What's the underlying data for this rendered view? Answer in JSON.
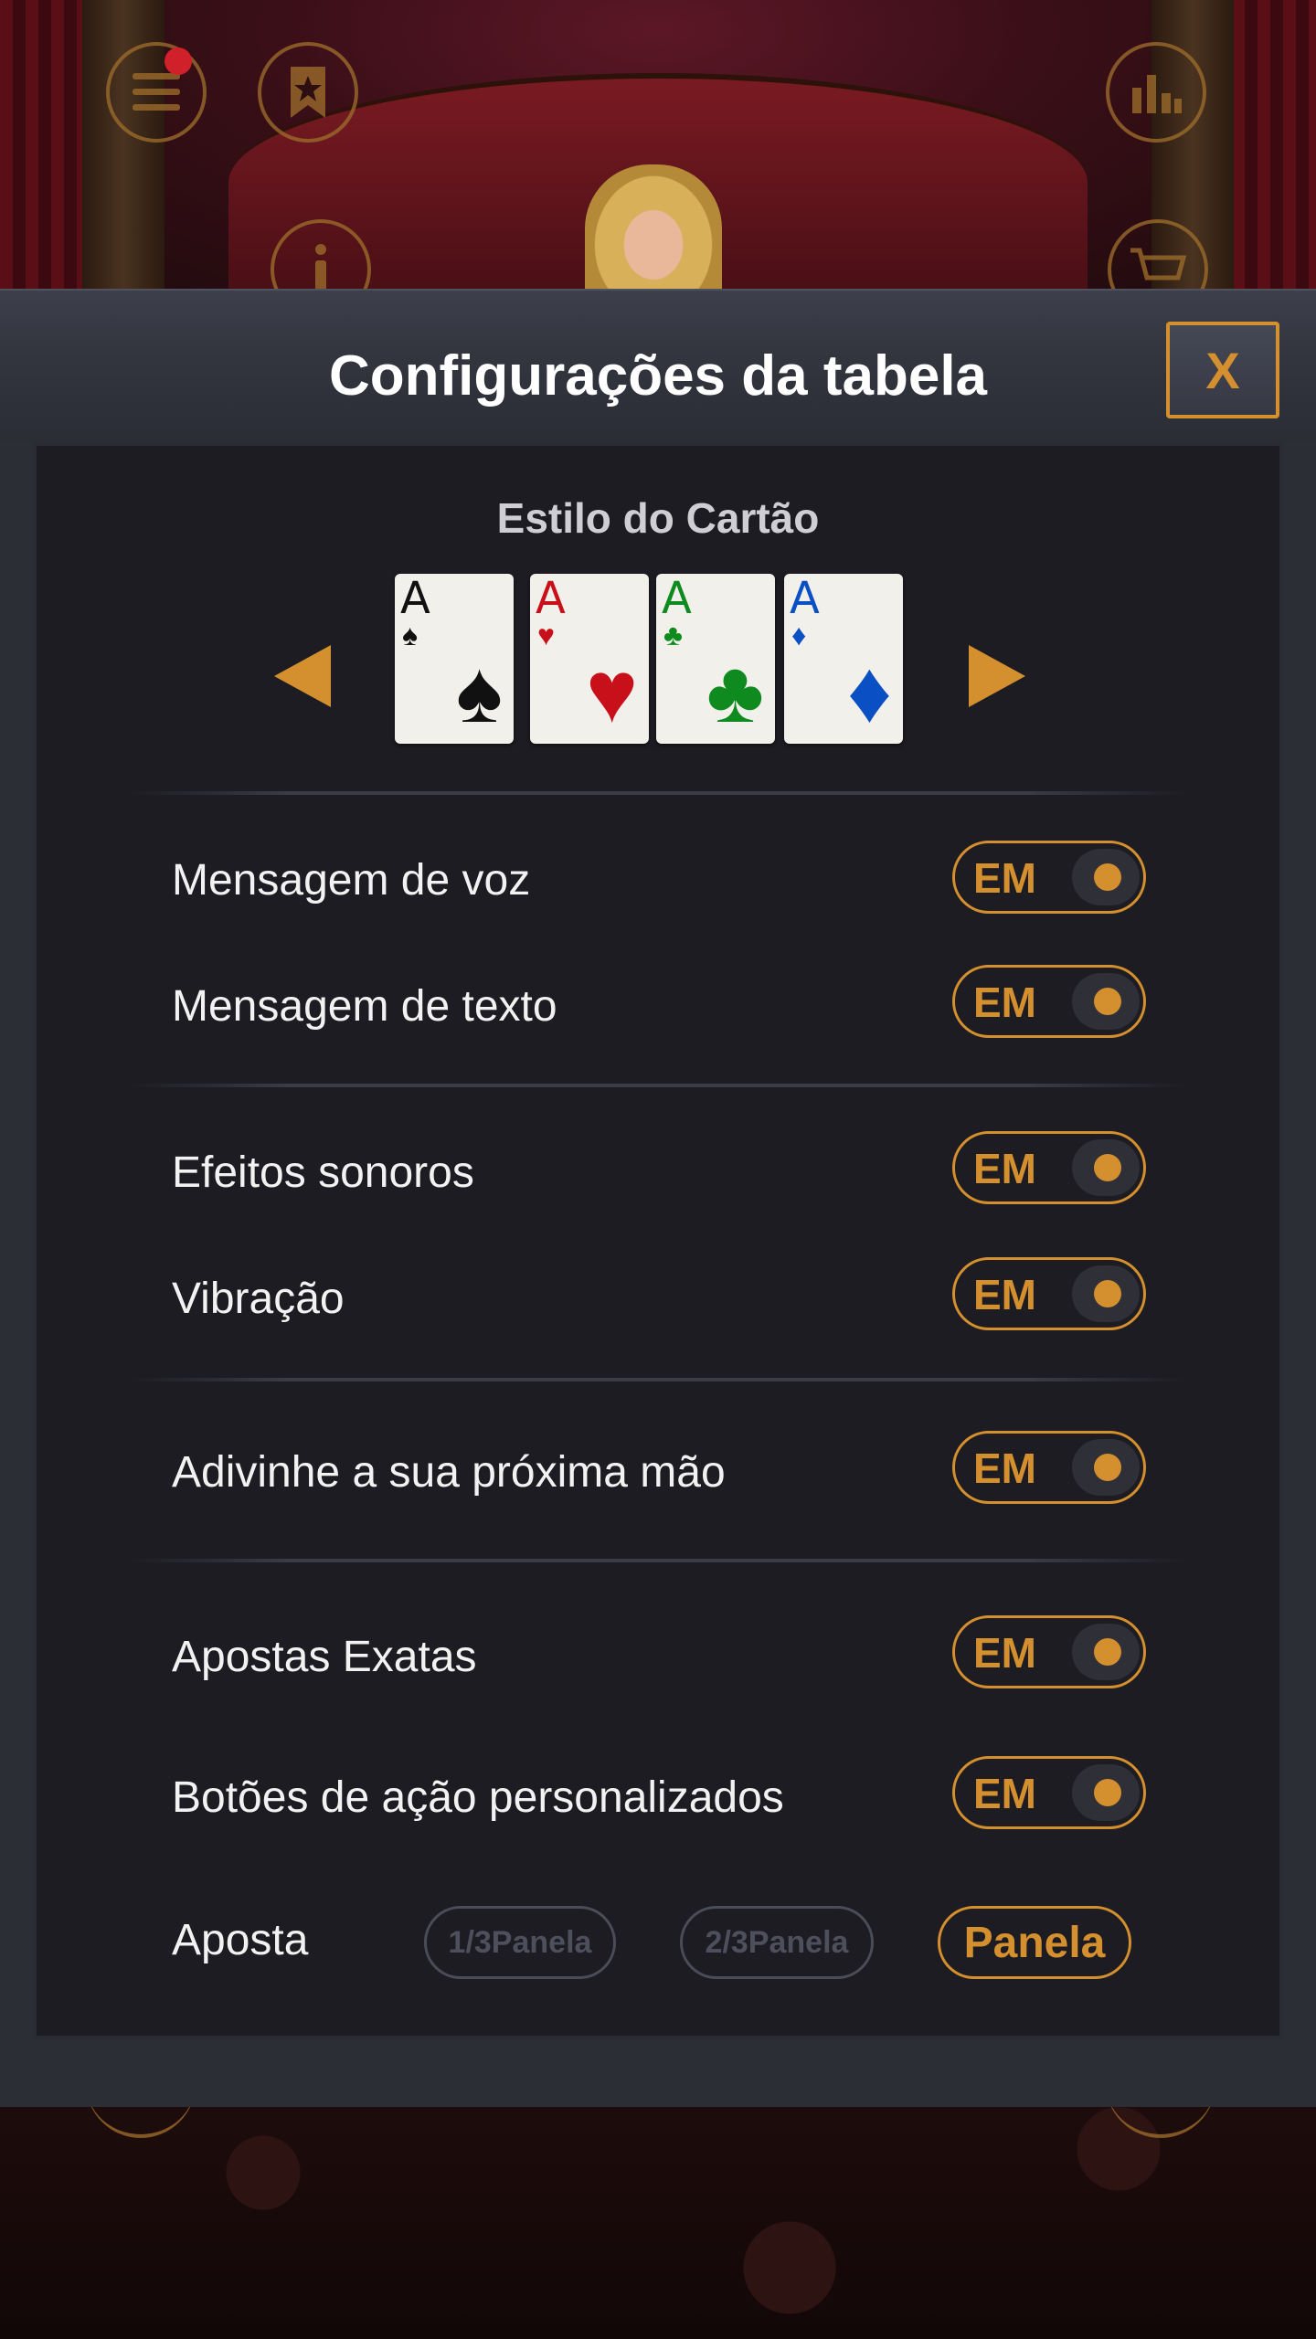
{
  "colors": {
    "accent": "#d48f2e",
    "panel_bg": "#1c1c22",
    "modal_bg": "#2c2e36",
    "text": "#f2f2f2",
    "inactive": "#4a4c58",
    "notification": "#d0202a"
  },
  "background": {
    "icons": [
      "menu-icon",
      "bookmark-icon",
      "info-icon",
      "stats-icon",
      "cart-icon"
    ]
  },
  "modal": {
    "title": "Configurações da tabela",
    "close_label": "X"
  },
  "card_style": {
    "title": "Estilo do Cartão",
    "cards": [
      {
        "rank": "A",
        "suit": "♠",
        "suit_name": "spade",
        "color": "#111111"
      },
      {
        "rank": "A",
        "suit": "♥",
        "suit_name": "heart",
        "color": "#c8101a"
      },
      {
        "rank": "A",
        "suit": "♣",
        "suit_name": "club",
        "color": "#0f8a1e"
      },
      {
        "rank": "A",
        "suit": "♦",
        "suit_name": "diamond",
        "color": "#0a4fc4"
      }
    ]
  },
  "settings": [
    {
      "label": "Mensagem de voz",
      "state": "EM"
    },
    {
      "label": "Mensagem de texto",
      "state": "EM"
    },
    {
      "label": "Efeitos sonoros",
      "state": "EM"
    },
    {
      "label": "Vibração",
      "state": "EM"
    },
    {
      "label": "Adivinhe a sua próxima mão",
      "state": "EM"
    },
    {
      "label": "Apostas Exatas",
      "state": "EM"
    },
    {
      "label": "Botões de ação personalizados",
      "state": "EM"
    }
  ],
  "bet": {
    "label": "Aposta",
    "options": [
      "1/3Panela",
      "2/3Panela",
      "Panela"
    ],
    "selected": "Panela"
  }
}
